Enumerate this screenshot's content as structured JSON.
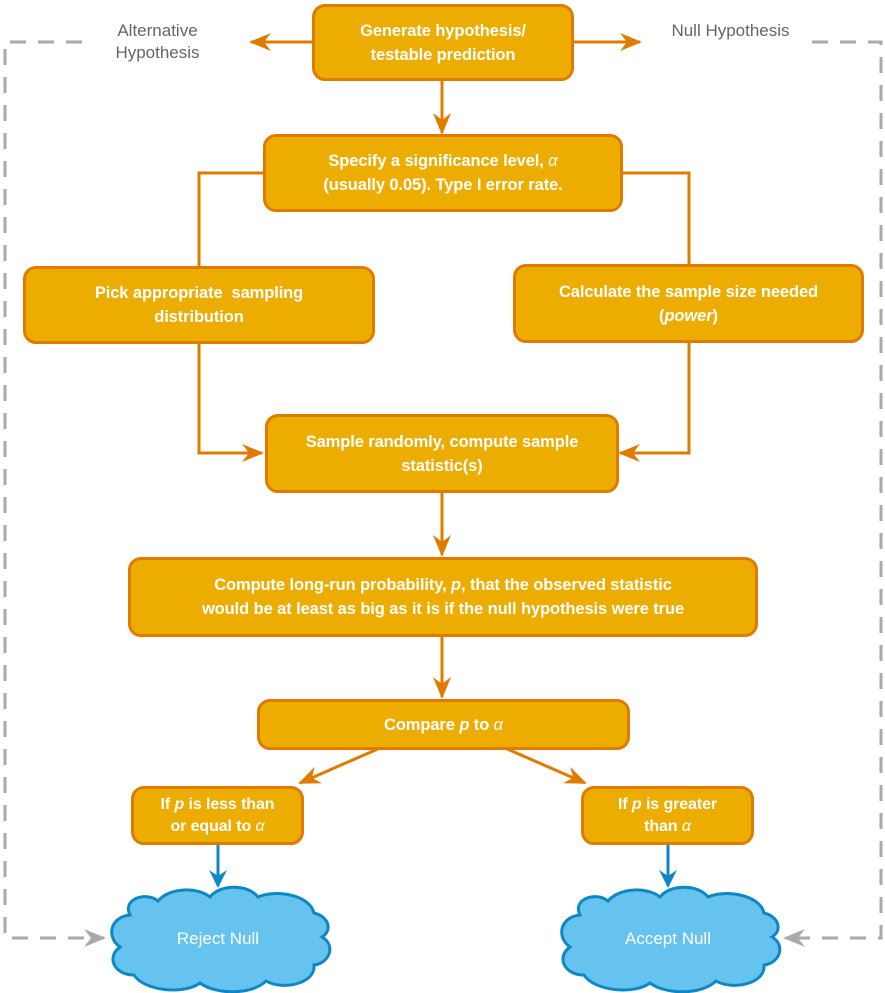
{
  "diagram": {
    "labels": {
      "alternative": "Alternative Hypothesis",
      "null": "Null Hypothesis"
    },
    "nodes": {
      "generate": {
        "line1": "Generate hypothesis/",
        "line2": "testable prediction"
      },
      "significance": {
        "line1a": "Specify a significance level, ",
        "line1_symbol": "α",
        "line2": "(usually 0.05). Type I error rate."
      },
      "sampling": {
        "line1": "Pick appropriate  sampling",
        "line2": "distribution"
      },
      "sample_size": {
        "line1": "Calculate the sample size needed",
        "line2_pre": "(",
        "line2_em": "power",
        "line2_post": ")"
      },
      "sample_randomly": {
        "line1": "Sample randomly, compute sample",
        "line2": "statistic(s)"
      },
      "probability": {
        "line1_pre": "Compute long-run probability, ",
        "line1_em": "p",
        "line1_post": ", that the observed statistic",
        "line2": "would be at least as big as it is if the null hypothesis were true"
      },
      "compare": {
        "pre": "Compare ",
        "em1": "p",
        "mid": " to ",
        "em2": "α"
      },
      "less_equal": {
        "pre": "If ",
        "em1": "p",
        "mid": " is less than",
        "line2_pre": "or equal to ",
        "em2": "α"
      },
      "greater": {
        "pre": "If ",
        "em1": "p",
        "mid": " is greater",
        "line2_pre": "than ",
        "em2": "α"
      }
    },
    "outcomes": {
      "reject": "Reject Null",
      "accept": "Accept Null"
    },
    "colors": {
      "box_fill": "#ecac00",
      "box_border": "#e07b00",
      "arrow_orange": "#e07b00",
      "arrow_blue": "#0e88c4",
      "cloud_fill": "#66c2ee",
      "cloud_stroke": "#0e88c4",
      "dashed_gray": "#aaaaaa",
      "label_gray": "#666666"
    }
  }
}
